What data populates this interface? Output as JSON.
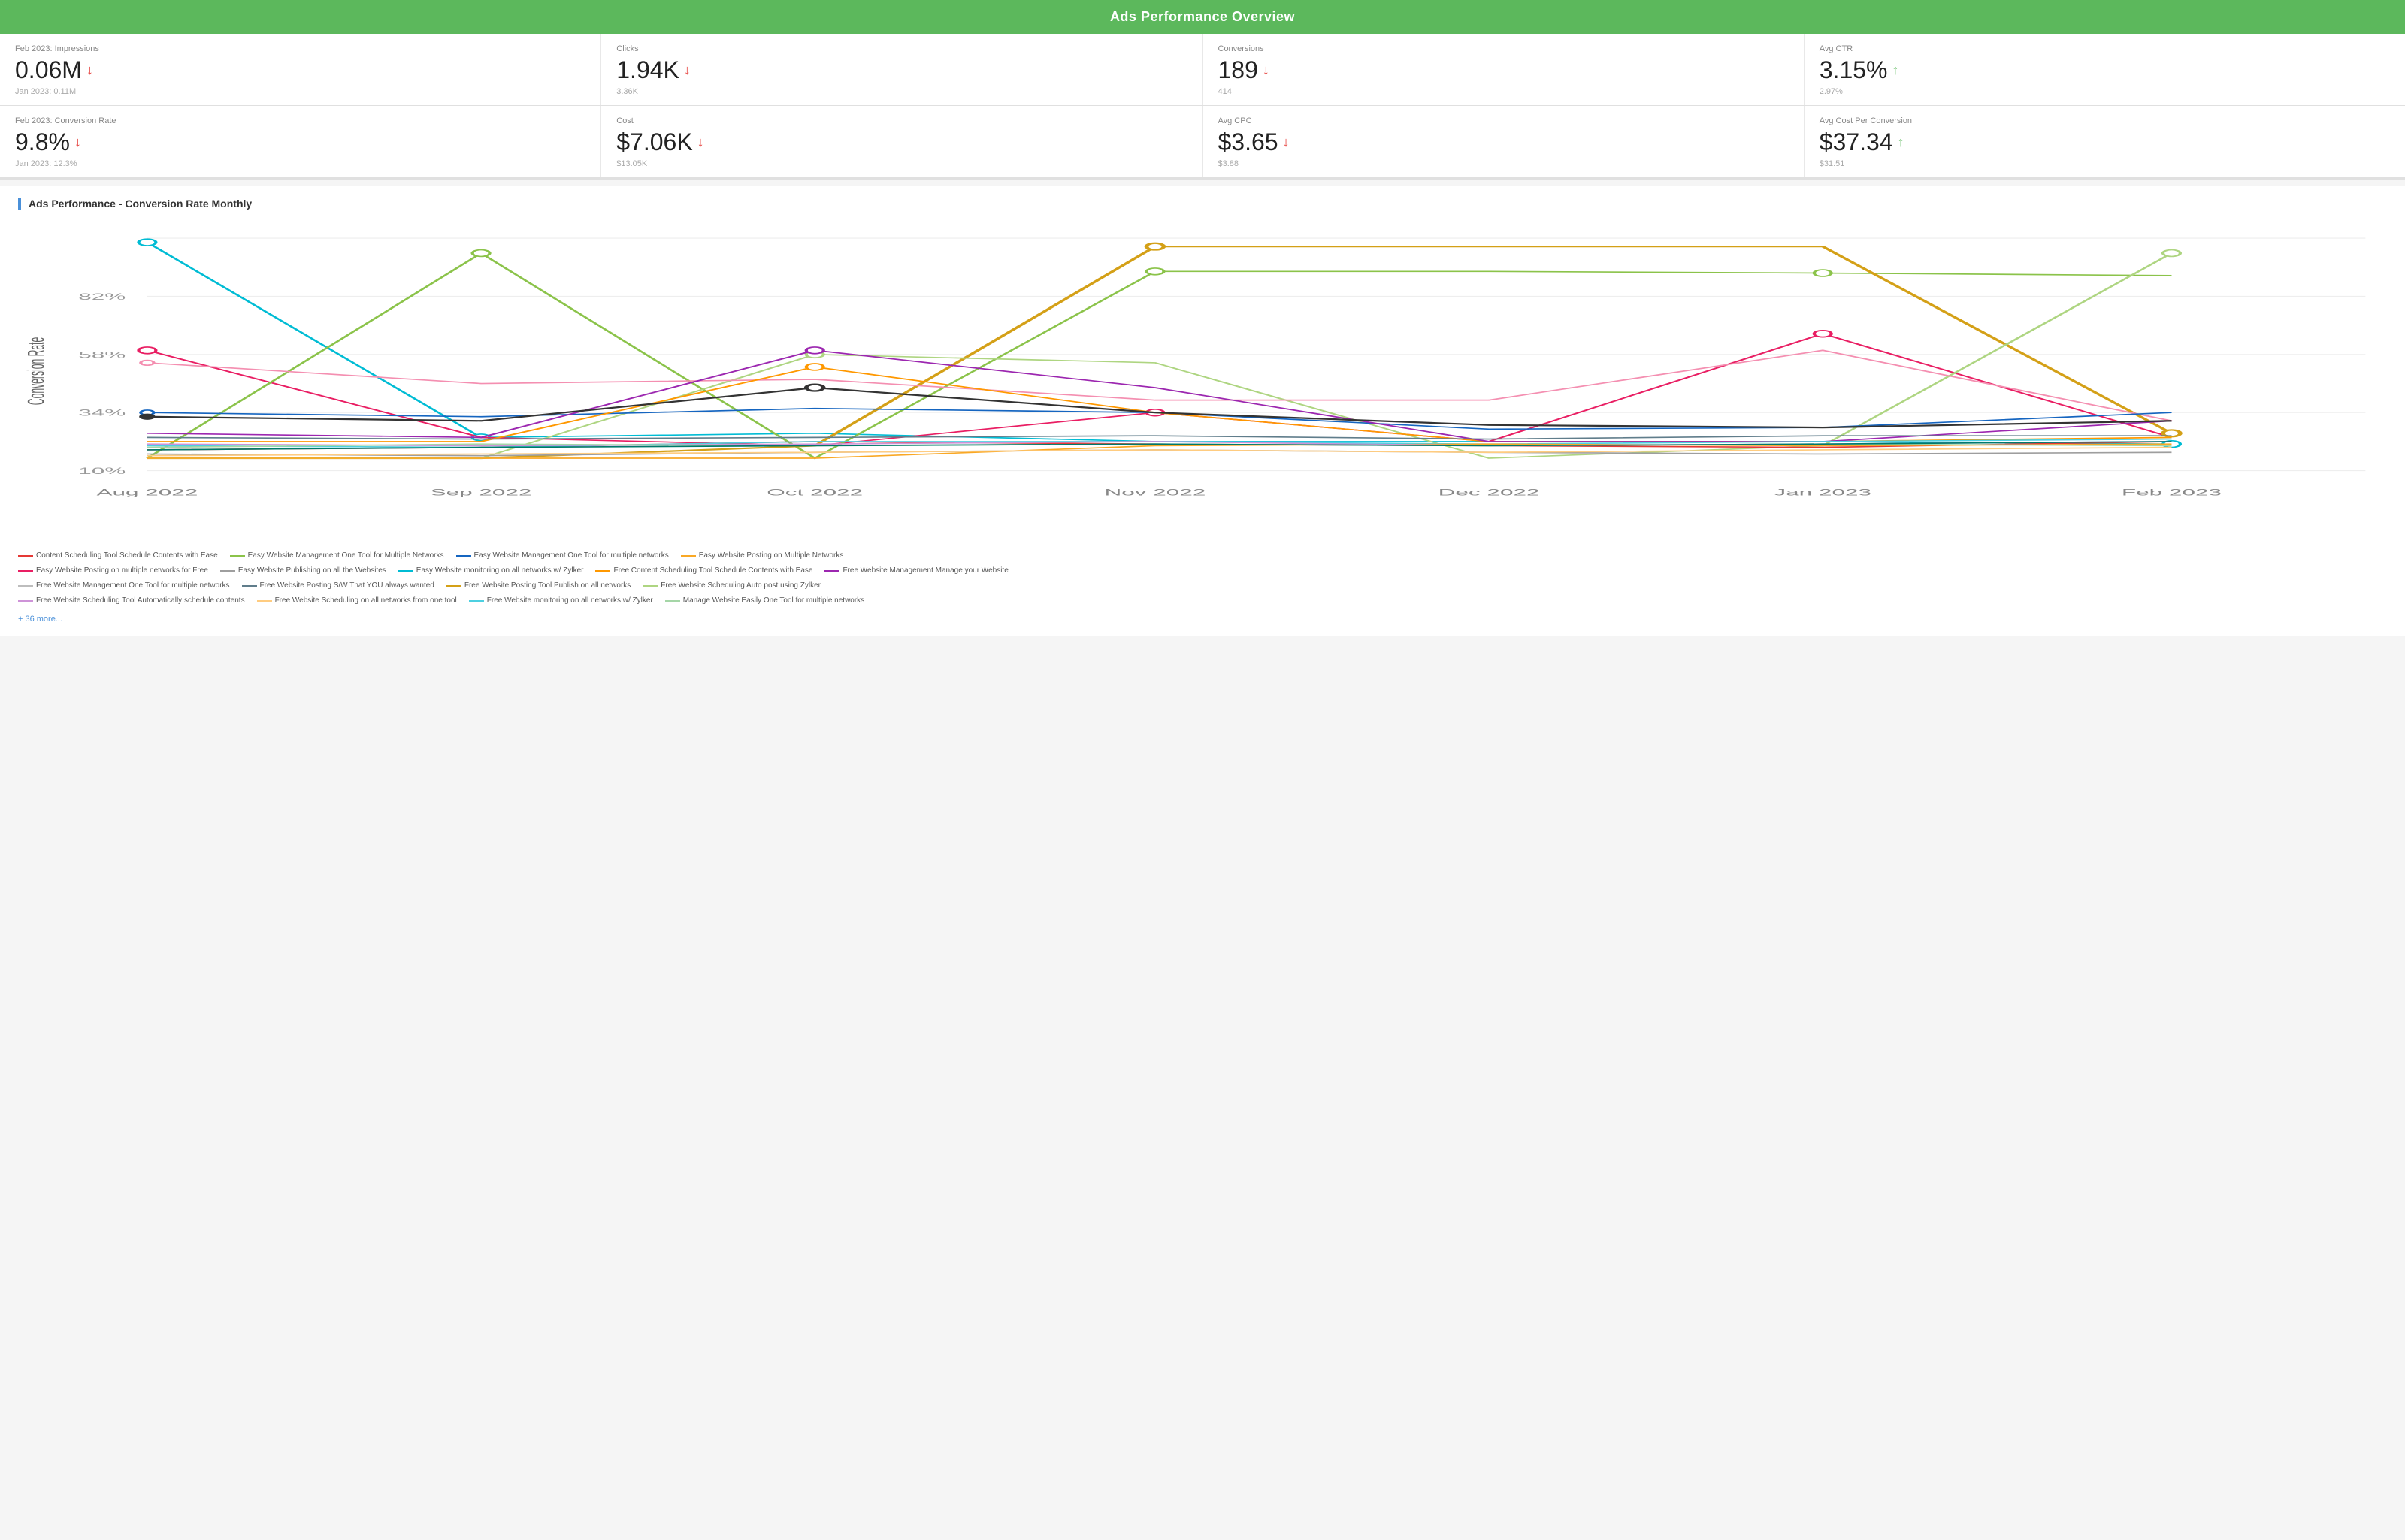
{
  "header": {
    "title": "Ads Performance Overview"
  },
  "metrics_row1": [
    {
      "label": "Feb 2023: Impressions",
      "value": "0.06M",
      "arrow": "down",
      "sub": "Jan 2023: 0.11M"
    },
    {
      "label": "Clicks",
      "value": "1.94K",
      "arrow": "down",
      "sub": "3.36K"
    },
    {
      "label": "Conversions",
      "value": "189",
      "arrow": "down",
      "sub": "414"
    },
    {
      "label": "Avg CTR",
      "value": "3.15%",
      "arrow": "up",
      "sub": "2.97%"
    }
  ],
  "metrics_row2": [
    {
      "label": "Feb 2023: Conversion Rate",
      "value": "9.8%",
      "arrow": "down",
      "sub": "Jan 2023: 12.3%"
    },
    {
      "label": "Cost",
      "value": "$7.06K",
      "arrow": "down",
      "sub": "$13.05K"
    },
    {
      "label": "Avg CPC",
      "value": "$3.65",
      "arrow": "down",
      "sub": "$3.88"
    },
    {
      "label": "Avg Cost Per Conversion",
      "value": "$37.34",
      "arrow": "up",
      "sub": "$31.51"
    }
  ],
  "chart": {
    "title": "Ads Performance - Conversion Rate Monthly",
    "y_axis_label": "Conversion Rate",
    "y_ticks": [
      "10%",
      "34%",
      "58%",
      "82%"
    ],
    "x_labels": [
      "Aug 2022",
      "Sep 2022",
      "Oct 2022",
      "Nov 2022",
      "Dec 2022",
      "Jan 2023",
      "Feb 2023"
    ]
  },
  "legend": {
    "items": [
      {
        "label": "Content Scheduling Tool Schedule Contents with Ease",
        "color": "#e53935"
      },
      {
        "label": "Easy Website Management One Tool for Multiple Networks",
        "color": "#8bc34a"
      },
      {
        "label": "Easy Website Management One Tool for multiple networks",
        "color": "#1565c0"
      },
      {
        "label": "Easy Website Posting on Multiple Networks",
        "color": "#f9a825"
      },
      {
        "label": "Easy Website Posting on multiple networks for Free",
        "color": "#e91e63"
      },
      {
        "label": "Easy Website Publishing on all the Websites",
        "color": "#9e9e9e"
      },
      {
        "label": "Easy Website monitoring on all networks w/ Zylker",
        "color": "#00bcd4"
      },
      {
        "label": "Free Content Scheduling Tool Schedule Contents with Ease",
        "color": "#ff9800"
      },
      {
        "label": "Free Website Management Manage your Website",
        "color": "#9c27b0"
      },
      {
        "label": "Free Website Management One Tool for multiple networks",
        "color": "#bdbdbd"
      },
      {
        "label": "Free Website Posting S/W That YOU always wanted",
        "color": "#607d8b"
      },
      {
        "label": "Free Website Posting Tool Publish on all networks",
        "color": "#d4a017"
      },
      {
        "label": "Free Website Scheduling Auto post using Zylker",
        "color": "#aed581"
      },
      {
        "label": "Free Website Scheduling Tool Automatically schedule contents",
        "color": "#ce93d8"
      },
      {
        "label": "Free Website Scheduling on all networks from one tool",
        "color": "#ffcc80"
      },
      {
        "label": "Free Website monitoring on all networks w/ Zylker",
        "color": "#4dd0e1"
      },
      {
        "label": "Manage Website Easily One Tool for multiple networks",
        "color": "#a5d6a7"
      }
    ],
    "more": "+ 36 more..."
  }
}
